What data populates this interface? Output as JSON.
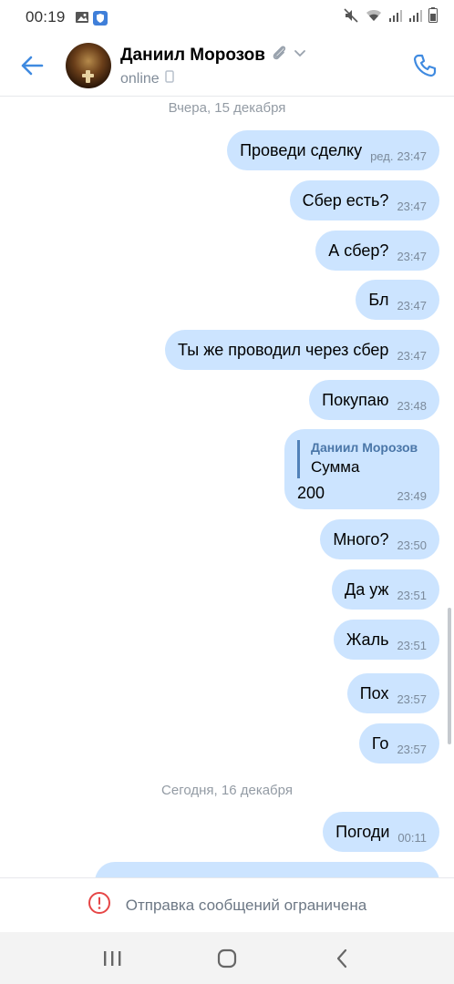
{
  "status_bar": {
    "time": "00:19",
    "left_icons": [
      "image-icon",
      "shield-icon"
    ],
    "right_icons": [
      "mute-icon",
      "wifi-icon",
      "signal-icon",
      "signal-icon",
      "battery-icon"
    ]
  },
  "header": {
    "contact_name": "Даниил Морозов",
    "status": "online",
    "icons": [
      "back-arrow-icon",
      "paperclip-icon",
      "chevron-down-icon",
      "mobile-icon",
      "phone-icon"
    ],
    "accent_color": "#3f8ae0"
  },
  "chat": {
    "bubble_color": "#cce4ff",
    "date_separators": [
      "Вчера, 15 декабря",
      "Сегодня, 16 декабря"
    ],
    "messages": [
      {
        "text": "Проведи сделку",
        "edited": "ред.",
        "time": "23:47"
      },
      {
        "text": "Сбер есть?",
        "time": "23:47"
      },
      {
        "text": "А сбер?",
        "time": "23:47"
      },
      {
        "text": "Бл",
        "time": "23:47"
      },
      {
        "text": "Ты же проводил через сбер",
        "time": "23:47"
      },
      {
        "text": "Покупаю",
        "time": "23:48"
      },
      {
        "quote_author": "Даниил Морозов",
        "quote_text": "Сумма",
        "text": "200",
        "time": "23:49"
      },
      {
        "text": "Много?",
        "time": "23:50"
      },
      {
        "text": "Да уж",
        "time": "23:51"
      },
      {
        "text": "Жаль",
        "time": "23:51"
      },
      {
        "text": "Пох",
        "time": "23:57"
      },
      {
        "text": "Го",
        "time": "23:57"
      },
      {
        "text": "Погоди",
        "time": "00:11"
      }
    ]
  },
  "restriction": {
    "text": "Отправка сообщений ограничена",
    "icon": "warning-circle-icon",
    "color": "#e64646"
  },
  "navbar": {
    "icons": [
      "recent-apps-icon",
      "home-icon",
      "back-nav-icon"
    ]
  }
}
